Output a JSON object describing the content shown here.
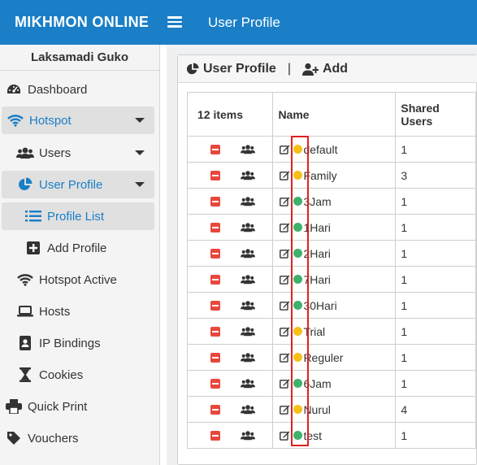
{
  "header": {
    "brand": "MIKHMON ONLINE",
    "page_title": "User Profile"
  },
  "sidebar": {
    "user_name": "Laksamadi Guko",
    "items": [
      {
        "label": "Dashboard",
        "icon": "dashboard-icon"
      },
      {
        "label": "Hotspot",
        "icon": "wifi-icon"
      },
      {
        "label": "Users",
        "icon": "users-icon"
      },
      {
        "label": "User Profile",
        "icon": "pie-chart-icon"
      },
      {
        "label": "Profile List",
        "icon": "list-icon"
      },
      {
        "label": "Add Profile",
        "icon": "plus-square-icon"
      },
      {
        "label": "Hotspot Active",
        "icon": "wifi-icon"
      },
      {
        "label": "Hosts",
        "icon": "laptop-icon"
      },
      {
        "label": "IP Bindings",
        "icon": "address-book-icon"
      },
      {
        "label": "Cookies",
        "icon": "hourglass-icon"
      },
      {
        "label": "Quick Print",
        "icon": "print-icon"
      },
      {
        "label": "Vouchers",
        "icon": "tag-icon"
      }
    ]
  },
  "card": {
    "title": "User Profile",
    "separator": "|",
    "add_label": "Add"
  },
  "table": {
    "item_count": "12 items",
    "col_name": "Name",
    "col_shared_line1": "Shared",
    "col_shared_line2": "Users",
    "rows": [
      {
        "name": "default",
        "shared": "1",
        "status": "yellow"
      },
      {
        "name": "Family",
        "shared": "3",
        "status": "yellow"
      },
      {
        "name": "3Jam",
        "shared": "1",
        "status": "green"
      },
      {
        "name": "1Hari",
        "shared": "1",
        "status": "green"
      },
      {
        "name": "2Hari",
        "shared": "1",
        "status": "green"
      },
      {
        "name": "7Hari",
        "shared": "1",
        "status": "green"
      },
      {
        "name": "30Hari",
        "shared": "1",
        "status": "green"
      },
      {
        "name": "Trial",
        "shared": "1",
        "status": "yellow"
      },
      {
        "name": "Reguler",
        "shared": "1",
        "status": "yellow"
      },
      {
        "name": "6Jam",
        "shared": "1",
        "status": "green"
      },
      {
        "name": "Nurul",
        "shared": "4",
        "status": "yellow"
      },
      {
        "name": "test",
        "shared": "1",
        "status": "green"
      }
    ]
  },
  "colors": {
    "topbar": "#1a7fc7",
    "accent_blue": "#1a7fc7",
    "delete_red": "#e8473d",
    "status_yellow": "#f5c018",
    "status_green": "#3fb16a",
    "highlight_red": "#e01f1f"
  }
}
